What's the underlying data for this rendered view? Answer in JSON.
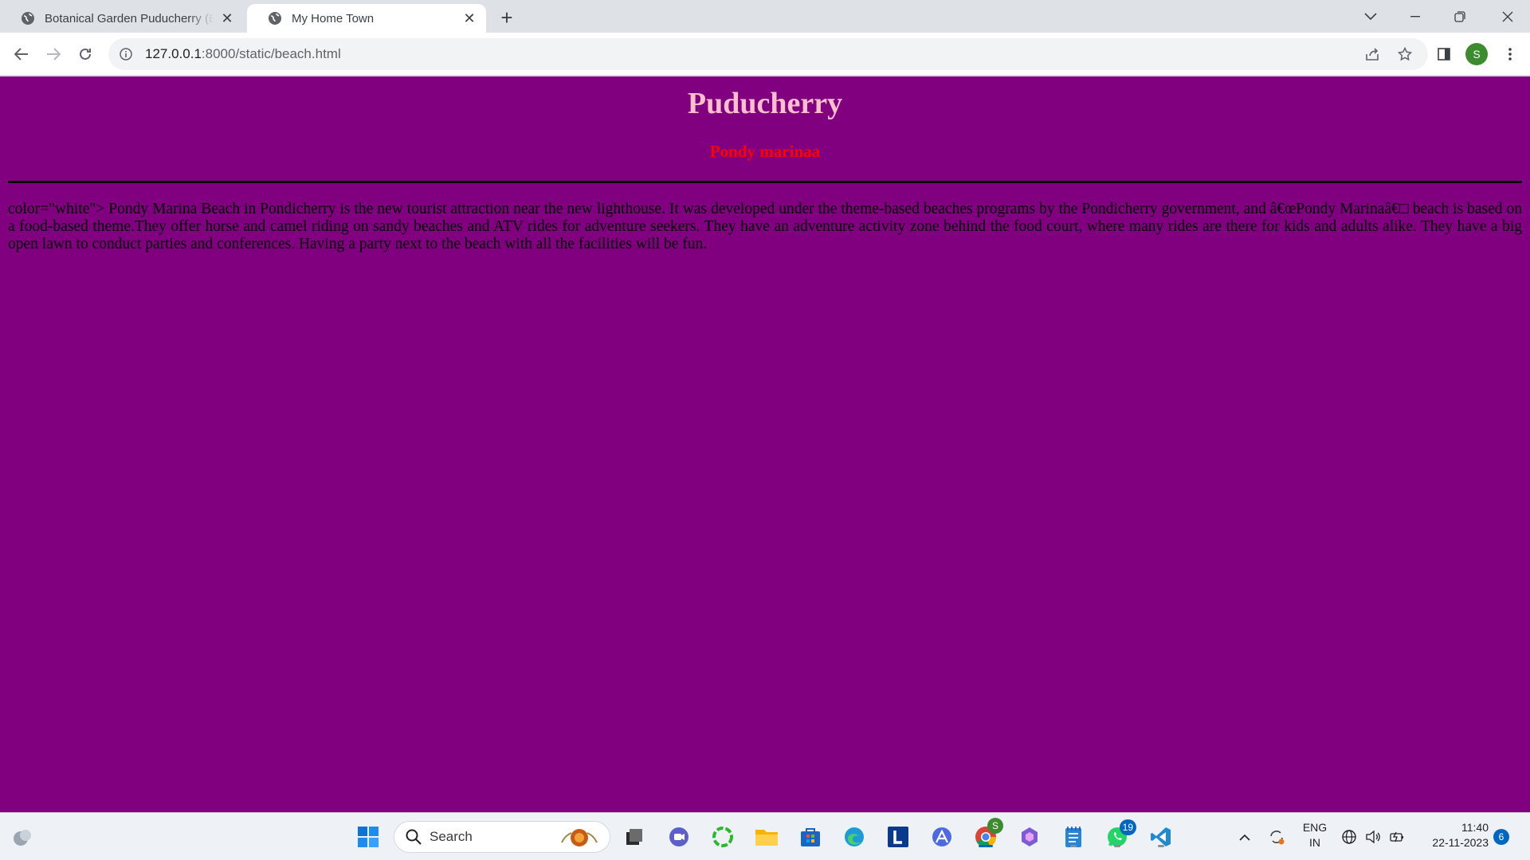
{
  "browser": {
    "tabs": [
      {
        "title": "Botanical Garden Puducherry (Er",
        "active": false
      },
      {
        "title": "My Home Town",
        "active": true
      }
    ],
    "url_host": "127.0.0.1",
    "url_rest": ":8000/static/beach.html",
    "profile_initial": "S"
  },
  "page": {
    "background": "#800080",
    "heading": "Puducherry",
    "subheading": "Pondy marinaa",
    "paragraph": "color=\"white\"> Pondy Marina Beach in Pondicherry is the new tourist attraction near the new lighthouse. It was developed under the theme-based beaches programs by the Pondicherry government, and â€œPondy Marinaâ€□ beach is based on a food-based theme.They offer horse and camel riding on sandy beaches and ATV rides for adventure seekers. They have an adventure activity zone behind the food court, where many rides are there for kids and adults alike. They have a big open lawn to conduct parties and conferences. Having a party next to the beach with all the facilities will be fun."
  },
  "taskbar": {
    "search_label": "Search",
    "chrome_badge": "S",
    "whatsapp_badge": "19",
    "language_line1": "ENG",
    "language_line2": "IN",
    "time": "11:40",
    "date": "22-11-2023",
    "notification_count": "6"
  }
}
